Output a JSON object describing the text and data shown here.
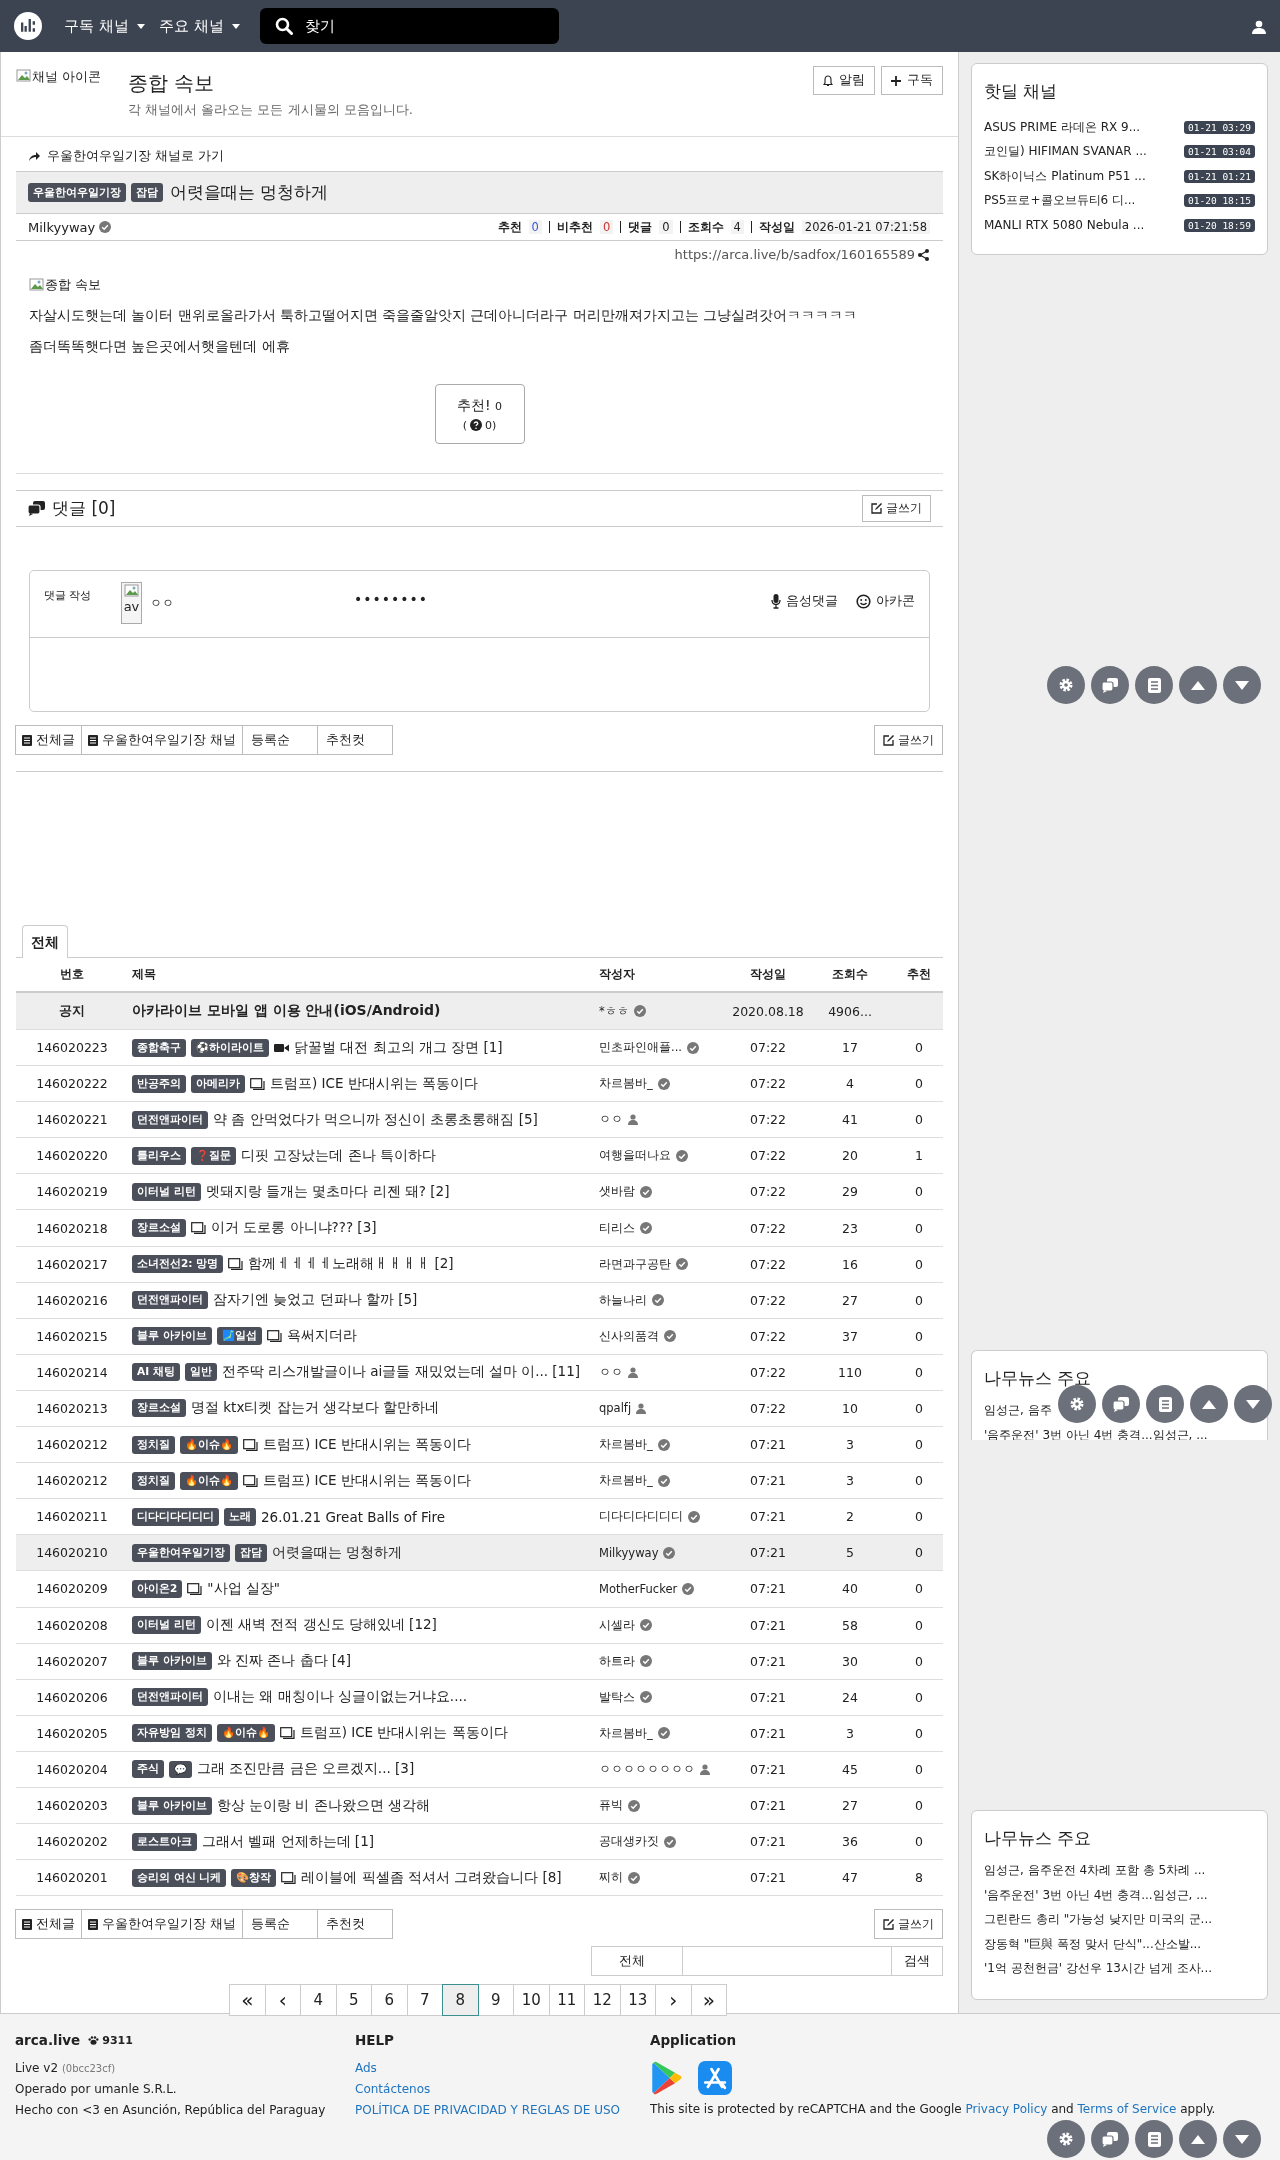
{
  "header": {
    "menus": [
      {
        "label": "구독 채널"
      },
      {
        "label": "주요 채널"
      }
    ],
    "search": {
      "placeholder": "찾기"
    }
  },
  "channel": {
    "icon_alt": "채널 아이콘",
    "title": "종합 속보",
    "description": "각 채널에서 올라오는 모든 게시물의 모음입니다.",
    "buttons": [
      {
        "kind": "bell",
        "label": "알림"
      },
      {
        "kind": "plus",
        "label": "구독"
      }
    ]
  },
  "article": {
    "back_link": "우울한여우일기장 채널로 가기",
    "badges": [
      "우울한여우일기장",
      "잡담"
    ],
    "title": "어렷을때는 멍청하게",
    "author": "Milkyyway",
    "stats": [
      {
        "label": "추천",
        "value": "0",
        "kind": "up"
      },
      {
        "label": "비추천",
        "value": "0",
        "kind": "down"
      },
      {
        "label": "댓글",
        "value": "0",
        "kind": "plain"
      },
      {
        "label": "조회수",
        "value": "4",
        "kind": "plain"
      },
      {
        "label": "작성일",
        "value": "2026-01-21 07:21:58",
        "kind": "date"
      }
    ],
    "url": "https://arca.live/b/sadfox/160165589",
    "image_alt": "종합 속보",
    "body": [
      "자살시도햇는데 놀이터 맨위로올라가서 툭하고떨어지면 죽을줄알앗지 근데아니더라구 머리만깨져가지고는 그냥실려갓어ㅋㅋㅋㅋㅋ",
      "좀더똑똑햇다면 높은곳에서햇을텐데 에휴"
    ],
    "vote": {
      "label": "추천!",
      "count": "0",
      "sub_open": "(",
      "sub": "0)"
    }
  },
  "comments": {
    "title": "댓글 [0]",
    "write": "글쓰기",
    "form": {
      "label": "댓글 작성",
      "avatar_alt": "av",
      "name": "ㅇㅇ",
      "password": "••••••••",
      "voice": "음성댓글",
      "emoticon": "아카콘"
    }
  },
  "filter_top": {
    "buttons": [
      {
        "label": "전체글",
        "kind": "doc"
      },
      {
        "label": "우울한여우일기장 채널",
        "kind": "doc"
      },
      {
        "label": "등록순",
        "kind": "plain"
      },
      {
        "label": "추천컷",
        "kind": "plain"
      }
    ],
    "write": "글쓰기"
  },
  "board": {
    "tabs": [
      {
        "label": "전체",
        "selected": true
      }
    ],
    "columns": [
      "번호",
      "제목",
      "작성자",
      "작성일",
      "조회수",
      "추천"
    ],
    "notice": {
      "label": "공지",
      "title": "아카라이브 모바일 앱 이용 안내(iOS/Android)",
      "author": "*ㅎㅎ",
      "date": "2020.08.18",
      "views": "4906..."
    },
    "rows": [
      {
        "id": "146020223",
        "badges": [
          "종합축구",
          "⚽하이라이트"
        ],
        "kind": "video",
        "title": "닭꿀벌 대전 최고의 개그 장면 [1]",
        "author": "민초파인애플...",
        "verified": true,
        "time": "07:22",
        "views": "17",
        "likes": "0",
        "selected": false
      },
      {
        "id": "146020222",
        "badges": [
          "반공주의",
          "아메리카"
        ],
        "kind": "image",
        "title": "트럼프) ICE 반대시위는 폭동이다",
        "author": "차르봄바_",
        "verified": true,
        "time": "07:22",
        "views": "4",
        "likes": "0",
        "selected": false
      },
      {
        "id": "146020221",
        "badges": [
          "던전앤파이터"
        ],
        "kind": "text",
        "title": "약 좀 안먹었다가 먹으니까 정신이 초롱초롱해짐 [5]",
        "author": "ㅇㅇ",
        "verified": false,
        "time": "07:22",
        "views": "41",
        "likes": "0",
        "selected": false
      },
      {
        "id": "146020220",
        "badges": [
          "틀리우스",
          "❓질문"
        ],
        "kind": "text",
        "title": "디핏 고장났는데 존나 특이하다",
        "author": "여행을떠나요",
        "verified": true,
        "time": "07:22",
        "views": "20",
        "likes": "1",
        "selected": false
      },
      {
        "id": "146020219",
        "badges": [
          "이터널 리턴"
        ],
        "kind": "text",
        "title": "멧돼지랑 들개는 몇초마다 리젠 돼? [2]",
        "author": "샛바람",
        "verified": true,
        "time": "07:22",
        "views": "29",
        "likes": "0",
        "selected": false
      },
      {
        "id": "146020218",
        "badges": [
          "장르소설"
        ],
        "kind": "image",
        "title": "이거 도로롱 아니냐??? [3]",
        "author": "티리스",
        "verified": true,
        "time": "07:22",
        "views": "23",
        "likes": "0",
        "selected": false
      },
      {
        "id": "146020217",
        "badges": [
          "소녀전선2: 망명"
        ],
        "kind": "image",
        "title": "함께ㅔㅔㅔㅔ노래해ㅐㅐㅐㅐ [2]",
        "author": "라면과구공탄",
        "verified": true,
        "time": "07:22",
        "views": "16",
        "likes": "0",
        "selected": false
      },
      {
        "id": "146020216",
        "badges": [
          "던전앤파이터"
        ],
        "kind": "text",
        "title": "잠자기엔 늦었고 던파나 할까 [5]",
        "author": "하늘나리",
        "verified": true,
        "time": "07:22",
        "views": "27",
        "likes": "0",
        "selected": false
      },
      {
        "id": "146020215",
        "badges": [
          "블루 아카이브",
          "🗾일섭"
        ],
        "kind": "image",
        "title": "욕써지더라",
        "author": "신사의품격",
        "verified": true,
        "time": "07:22",
        "views": "37",
        "likes": "0",
        "selected": false
      },
      {
        "id": "146020214",
        "badges": [
          "AI 채팅",
          "일반"
        ],
        "kind": "text",
        "title": "전주딱 리스개발글이나 ai글들 재밌었는데 설마 이... [11]",
        "author": "ㅇㅇ",
        "verified": false,
        "time": "07:22",
        "views": "110",
        "likes": "0",
        "selected": false
      },
      {
        "id": "146020213",
        "badges": [
          "장르소설"
        ],
        "kind": "text",
        "title": "명절 ktx티켓 잡는거 생각보다 할만하네",
        "author": "qpalfj",
        "verified": false,
        "time": "07:22",
        "views": "10",
        "likes": "0",
        "selected": false
      },
      {
        "id": "146020212",
        "badges": [
          "정치질",
          "🔥이슈🔥"
        ],
        "kind": "image",
        "title": "트럼프) ICE 반대시위는 폭동이다",
        "author": "차르봄바_",
        "verified": true,
        "time": "07:21",
        "views": "3",
        "likes": "0",
        "selected": false
      },
      {
        "id": "146020212",
        "badges": [
          "정치질",
          "🔥이슈🔥"
        ],
        "kind": "image",
        "title": "트럼프) ICE 반대시위는 폭동이다",
        "author": "차르봄바_",
        "verified": true,
        "time": "07:21",
        "views": "3",
        "likes": "0",
        "selected": false
      },
      {
        "id": "146020211",
        "badges": [
          "디다디다디디디",
          "노래"
        ],
        "kind": "text",
        "title": "26.01.21 Great Balls of Fire",
        "author": "디다디다디디디",
        "verified": true,
        "time": "07:21",
        "views": "2",
        "likes": "0",
        "selected": false
      },
      {
        "id": "146020210",
        "badges": [
          "우울한여우일기장",
          "잡담"
        ],
        "kind": "text",
        "title": "어렷을때는 멍청하게",
        "author": "Milkyyway",
        "verified": true,
        "time": "07:21",
        "views": "5",
        "likes": "0",
        "selected": true
      },
      {
        "id": "146020209",
        "badges": [
          "아이온2"
        ],
        "kind": "image",
        "title": "\"사업 실장\"",
        "author": "MotherFucker",
        "verified": true,
        "time": "07:21",
        "views": "40",
        "likes": "0",
        "selected": false
      },
      {
        "id": "146020208",
        "badges": [
          "이터널 리턴"
        ],
        "kind": "text",
        "title": "이젠 새벽 전적 갱신도 당해있네 [12]",
        "author": "시셀라",
        "verified": true,
        "time": "07:21",
        "views": "58",
        "likes": "0",
        "selected": false
      },
      {
        "id": "146020207",
        "badges": [
          "블루 아카이브"
        ],
        "kind": "text",
        "title": "와 진짜 존나 춥다 [4]",
        "author": "하트라",
        "verified": true,
        "time": "07:21",
        "views": "30",
        "likes": "0",
        "selected": false
      },
      {
        "id": "146020206",
        "badges": [
          "던전앤파이터"
        ],
        "kind": "text",
        "title": "이내는 왜 매칭이나 싱글이없는거냐요....",
        "author": "발탁스",
        "verified": true,
        "time": "07:21",
        "views": "24",
        "likes": "0",
        "selected": false
      },
      {
        "id": "146020205",
        "badges": [
          "자유방임 정치",
          "🔥이슈🔥"
        ],
        "kind": "image",
        "title": "트럼프) ICE 반대시위는 폭동이다",
        "author": "차르봄바_",
        "verified": true,
        "time": "07:21",
        "views": "3",
        "likes": "0",
        "selected": false
      },
      {
        "id": "146020204",
        "badges": [
          "주식",
          "💬"
        ],
        "kind": "text",
        "title": "그래 조진만큼 금은 오르겠지... [3]",
        "author": "ㅇㅇㅇㅇㅇㅇㅇㅇ",
        "verified": false,
        "time": "07:21",
        "views": "45",
        "likes": "0",
        "selected": false
      },
      {
        "id": "146020203",
        "badges": [
          "블루 아카이브"
        ],
        "kind": "text",
        "title": "항상 눈이랑 비 존나왔으면 생각해",
        "author": "퓨빅",
        "verified": true,
        "time": "07:21",
        "views": "27",
        "likes": "0",
        "selected": false
      },
      {
        "id": "146020202",
        "badges": [
          "로스트아크"
        ],
        "kind": "text",
        "title": "그래서 벨패 언제하는데 [1]",
        "author": "공대생카짓",
        "verified": true,
        "time": "07:21",
        "views": "36",
        "likes": "0",
        "selected": false
      },
      {
        "id": "146020201",
        "badges": [
          "승리의 여신 니케",
          "🎨창작"
        ],
        "kind": "image",
        "title": "레이블에 픽셀좀 적셔서 그려왔습니다 [8]",
        "author": "찌히",
        "verified": true,
        "time": "07:21",
        "views": "47",
        "likes": "8",
        "selected": false
      }
    ]
  },
  "filter_bottom": {
    "buttons": [
      {
        "label": "전체글",
        "kind": "doc"
      },
      {
        "label": "우울한여우일기장 채널",
        "kind": "doc"
      },
      {
        "label": "등록순",
        "kind": "plain"
      },
      {
        "label": "추천컷",
        "kind": "plain"
      }
    ],
    "write": "글쓰기"
  },
  "board_search": {
    "scope": "전체",
    "button": "검색"
  },
  "pagination": {
    "pages": [
      {
        "label": "«",
        "kind": "first",
        "selected": false
      },
      {
        "label": "‹",
        "kind": "prev",
        "selected": false
      },
      {
        "label": "4",
        "kind": "page",
        "selected": false
      },
      {
        "label": "5",
        "kind": "page",
        "selected": false
      },
      {
        "label": "6",
        "kind": "page",
        "selected": false
      },
      {
        "label": "7",
        "kind": "page",
        "selected": false
      },
      {
        "label": "8",
        "kind": "page",
        "selected": true
      },
      {
        "label": "9",
        "kind": "page",
        "selected": false
      },
      {
        "label": "10",
        "kind": "page",
        "selected": false
      },
      {
        "label": "11",
        "kind": "page",
        "selected": false
      },
      {
        "label": "12",
        "kind": "page",
        "selected": false
      },
      {
        "label": "13",
        "kind": "page",
        "selected": false
      },
      {
        "label": "›",
        "kind": "next",
        "selected": false
      },
      {
        "label": "»",
        "kind": "last",
        "selected": false
      }
    ]
  },
  "sidebar": {
    "hotdeal": {
      "title": "핫딜 채널",
      "items": [
        {
          "title": "ASUS PRIME 라데온 RX 9...",
          "date": "01-21 03:29"
        },
        {
          "title": "코인딜) HIFIMAN SVANAR ...",
          "date": "01-21 03:04"
        },
        {
          "title": "SK하이닉스 Platinum P51 ...",
          "date": "01-21 01:21"
        },
        {
          "title": "PS5프로+콜오브듀티6 디...",
          "date": "01-20 18:15"
        },
        {
          "title": "MANLI RTX 5080 Nebula ...",
          "date": "01-20 18:59"
        }
      ]
    },
    "news_clipped": {
      "title": "나무뉴스 주요",
      "items": [
        "임성근, 음주",
        "'음주운전' 3번 아닌 4번 충격...임성근, ..."
      ]
    },
    "news": {
      "title": "나무뉴스 주요",
      "items": [
        "임성근, 음주운전 4차례 포함 총 5차례 ...",
        "'음주운전' 3번 아닌 4번 충격...임성근, ...",
        "그린란드 총리 \"가능성 낮지만 미국의 군...",
        "장동혁 \"巨與 폭정 맞서 단식\"...산소발...",
        "'1억 공천헌금' 강선우 13시간 넘게 조사..."
      ]
    }
  },
  "footer": {
    "brand": "arca.live",
    "count": "9311",
    "version": "Live v2",
    "build": "(0bcc23cf)",
    "lines": [
      "Operado por umanle S.R.L.",
      "Hecho con <3 en Asunción, República del Paraguay"
    ],
    "help": {
      "title": "HELP",
      "links": [
        "Ads",
        "Contáctenos",
        "POLÍTICA DE PRIVACIDAD Y REGLAS DE USO"
      ]
    },
    "app": {
      "title": "Application",
      "notice_before": "This site is protected by reCAPTCHA and the Google",
      "link1": "Privacy Policy",
      "notice_middle": "and",
      "link2": "Terms of Service",
      "notice_after": "apply."
    }
  },
  "floating_buttons": [
    {
      "kind": "settings"
    },
    {
      "kind": "comments"
    },
    {
      "kind": "list"
    },
    {
      "kind": "up"
    },
    {
      "kind": "down"
    }
  ]
}
